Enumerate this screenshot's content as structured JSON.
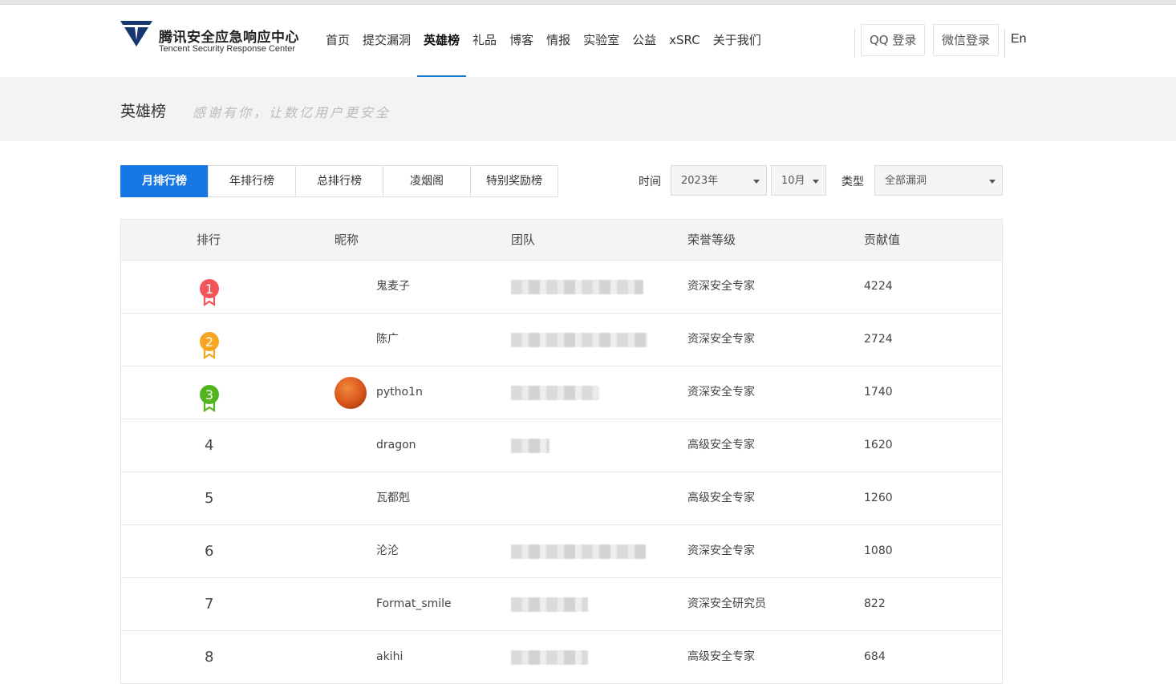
{
  "header": {
    "logo_cn": "腾讯安全应急响应中心",
    "logo_en": "Tencent Security Response Center",
    "nav": [
      "首页",
      "提交漏洞",
      "英雄榜",
      "礼品",
      "博客",
      "情报",
      "实验室",
      "公益",
      "xSRC",
      "关于我们"
    ],
    "active_nav": "英雄榜",
    "qq_login": "QQ 登录",
    "wechat_login": "微信登录",
    "lang": "En",
    "accent_color": "#1677d2"
  },
  "banner": {
    "title": "英雄榜",
    "subtitle": "感谢有你，让数亿用户更安全"
  },
  "tabs": [
    "月排行榜",
    "年排行榜",
    "总排行榜",
    "凌烟阁",
    "特别奖励榜"
  ],
  "filters": {
    "time_label": "时间",
    "year": "2023年",
    "month": "10月",
    "type_label": "类型",
    "type": "全部漏洞"
  },
  "table": {
    "headers": [
      "排行",
      "昵称",
      "团队",
      "荣誉等级",
      "贡献值"
    ],
    "rows": [
      {
        "rank": "1",
        "medal_color": "#f2555a",
        "nickname": "鬼麦子",
        "team_blurred": true,
        "level": "资深安全专家",
        "score": "4224"
      },
      {
        "rank": "2",
        "medal_color": "#f5a623",
        "nickname": "陈广",
        "team_blurred": true,
        "level": "资深安全专家",
        "score": "2724"
      },
      {
        "rank": "3",
        "medal_color": "#52b51f",
        "nickname": "pytho1n",
        "avatar": true,
        "team_blurred": true,
        "level": "资深安全专家",
        "score": "1740"
      },
      {
        "rank": "4",
        "nickname": "dragon",
        "team_blurred": true,
        "level": "高级安全专家",
        "score": "1620"
      },
      {
        "rank": "5",
        "nickname": "瓦都剋",
        "team_blurred": false,
        "level": "高级安全专家",
        "score": "1260"
      },
      {
        "rank": "6",
        "nickname": "沦沦",
        "team_blurred": true,
        "level": "资深安全专家",
        "score": "1080"
      },
      {
        "rank": "7",
        "nickname": "Format_smile",
        "team_blurred": true,
        "level": "资深安全研究员",
        "score": "822"
      },
      {
        "rank": "8",
        "nickname": "akihi",
        "team_blurred": true,
        "level": "高级安全专家",
        "score": "684"
      }
    ]
  }
}
